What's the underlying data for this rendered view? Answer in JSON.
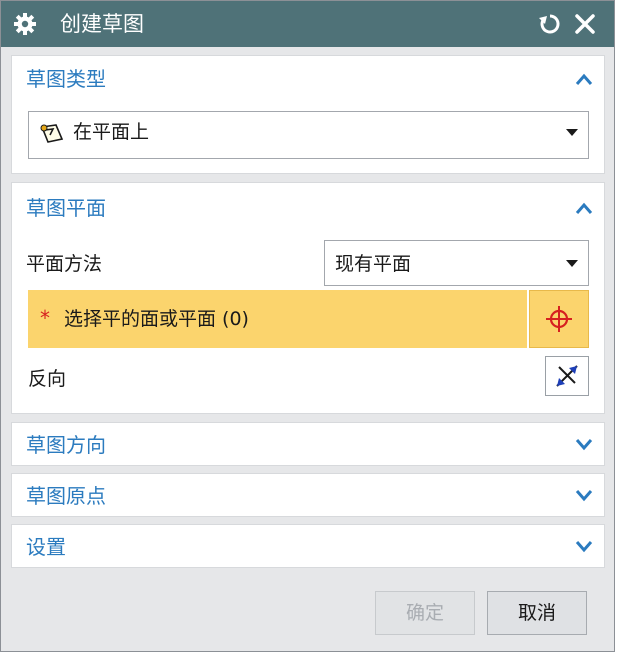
{
  "dialog": {
    "title": "创建草图",
    "icons": {
      "settings": "gear-icon",
      "reset": "reset-icon",
      "close": "close-icon"
    }
  },
  "sketch_type": {
    "title": "草图类型",
    "expanded": true,
    "value": "在平面上"
  },
  "sketch_plane": {
    "title": "草图平面",
    "expanded": true,
    "method_label": "平面方法",
    "method_value": "现有平面",
    "select_required_mark": "*",
    "select_label": "选择平的面或平面 (0)",
    "reverse_label": "反向"
  },
  "sketch_orientation": {
    "title": "草图方向",
    "expanded": false
  },
  "sketch_origin": {
    "title": "草图原点",
    "expanded": false
  },
  "settings": {
    "title": "设置",
    "expanded": false
  },
  "footer": {
    "ok_label": "确定",
    "ok_enabled": false,
    "cancel_label": "取消"
  },
  "colors": {
    "titlebar": "#4f7278",
    "section_title": "#2b7bbf",
    "selection_highlight": "#fbd46d",
    "required_mark": "#d62020"
  }
}
